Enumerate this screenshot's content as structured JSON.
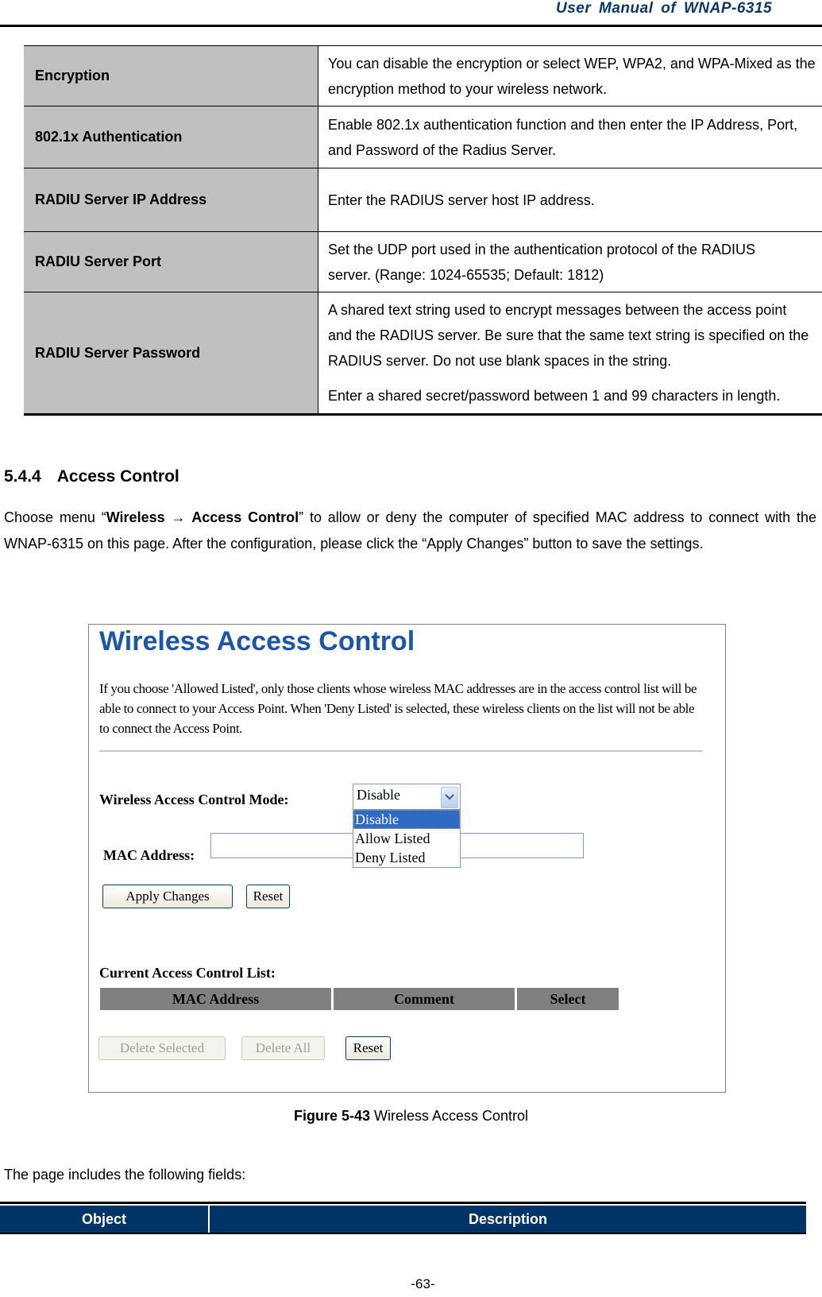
{
  "header": {
    "title": "User  Manual  of  WNAP-6315"
  },
  "spec_table": {
    "rows": [
      {
        "key": "Encryption",
        "desc": [
          "You can disable the encryption or select WEP, WPA2, and WPA-Mixed as the encryption method to your wireless network."
        ]
      },
      {
        "key": "802.1x Authentication",
        "desc": [
          "Enable 802.1x authentication function and then enter the IP Address, Port, and Password of the Radius Server."
        ]
      },
      {
        "key": "RADIU Server IP Address",
        "desc": [
          "Enter the RADIUS server host IP address."
        ]
      },
      {
        "key": "RADIU Server Port",
        "desc": [
          "Set the UDP port used in the authentication protocol of the RADIUS server. (Range: 1024-65535; Default: 1812)"
        ]
      },
      {
        "key": "RADIU Server Password",
        "desc": [
          "A shared text string used to encrypt messages between the access point and the RADIUS server. Be sure that the same text string is specified on the RADIUS server. Do not use blank spaces in the string.",
          "Enter a shared secret/password between 1 and 99 characters in length."
        ]
      }
    ]
  },
  "section": {
    "number": "5.4.4",
    "title": "Access Control",
    "intro_pre": "Choose menu “",
    "intro_menu1": "Wireless",
    "intro_arrow": "→",
    "intro_menu2": "Access Control",
    "intro_post": "” to allow or deny the computer of specified MAC address to connect with the WNAP-6315 on this page. After the configuration, please click the “Apply Changes” button to save the settings."
  },
  "figure": {
    "title": "Wireless Access Control",
    "description": "If you choose 'Allowed Listed', only those clients whose wireless MAC addresses are in the access control list will be able to connect to your Access Point. When 'Deny Listed' is selected, these wireless clients on the list will not be able to connect the Access Point.",
    "mode_label": "Wireless Access Control Mode:",
    "mode_value": "Disable",
    "mode_options": [
      "Disable",
      "Allow Listed",
      "Deny Listed"
    ],
    "mac_label": "MAC Address:",
    "mac_value": "",
    "apply_label": "Apply Changes",
    "reset_label": "Reset",
    "list_label": "Current Access Control List:",
    "list_columns": [
      "MAC Address",
      "Comment",
      "Select"
    ],
    "delete_selected_label": "Delete Selected",
    "delete_all_label": "Delete All",
    "reset2_label": "Reset"
  },
  "caption": {
    "bold": "Figure 5-43",
    "text": " Wireless Access Control"
  },
  "fields_intro": "The page includes the following fields:",
  "object_table": {
    "col1": "Object",
    "col2": "Description"
  },
  "page_number": "-63-"
}
